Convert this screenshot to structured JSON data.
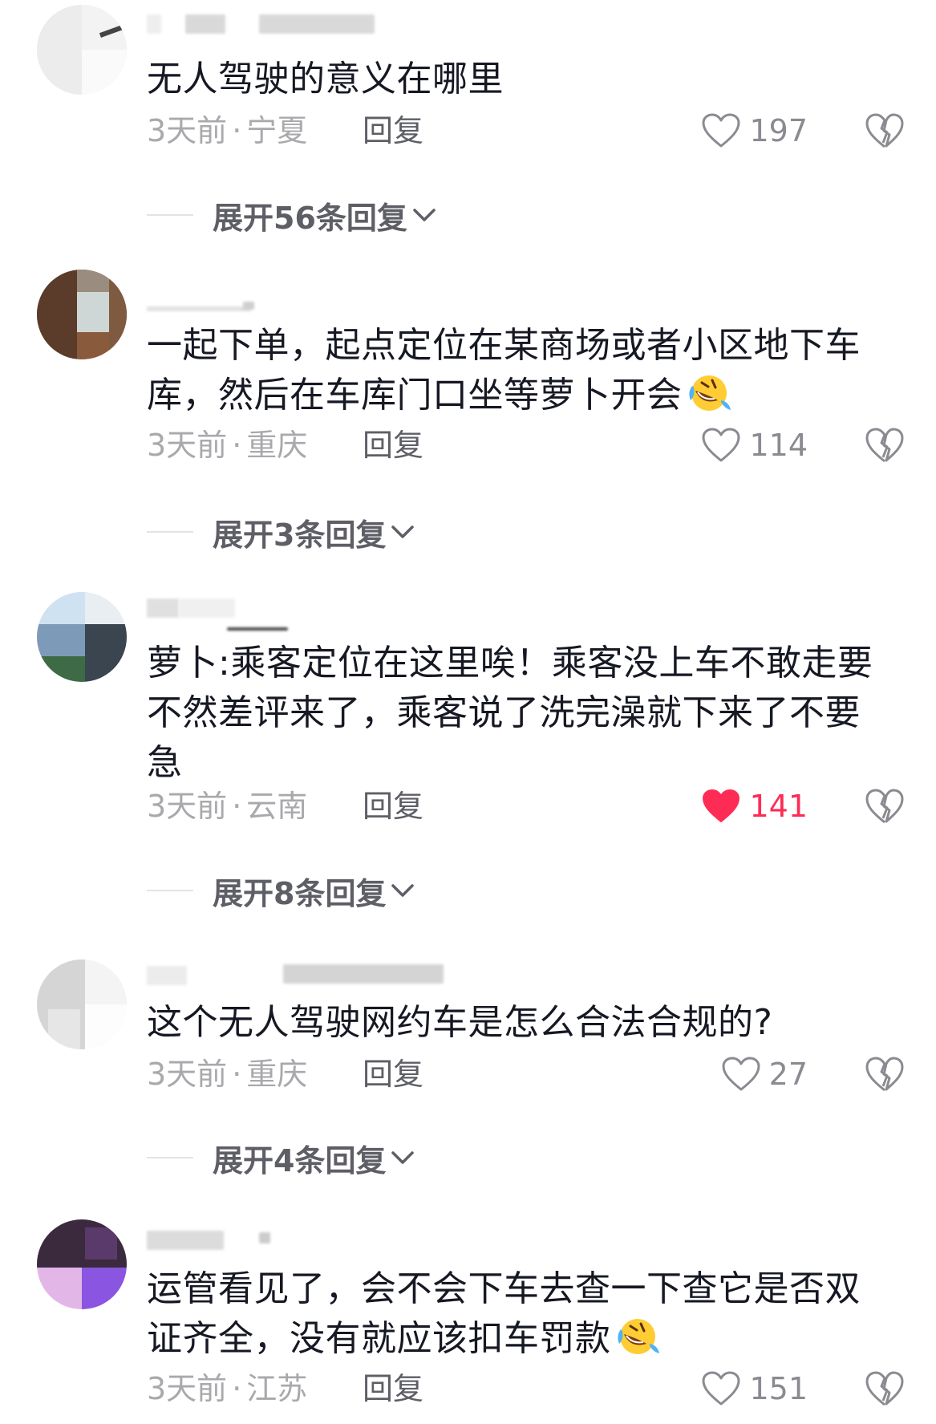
{
  "comments": [
    {
      "text": "无人驾驶的意义在哪里",
      "time": "3天前",
      "location": "宁夏",
      "reply_label": "回复",
      "likes": "197",
      "liked": false,
      "expand_label": "展开56条回复"
    },
    {
      "text": "一起下单，起点定位在某商场或者小区地下车库，然后在车库门口坐等萝卜开会",
      "emoji": "rolling-on-floor-laughing-emoji",
      "time": "3天前",
      "location": "重庆",
      "reply_label": "回复",
      "likes": "114",
      "liked": false,
      "expand_label": "展开3条回复"
    },
    {
      "text": "萝卜:乘客定位在这里唉！乘客没上车不敢走要不然差评来了，乘客说了洗完澡就下来了不要急",
      "time": "3天前",
      "location": "云南",
      "reply_label": "回复",
      "likes": "141",
      "liked": true,
      "expand_label": "展开8条回复"
    },
    {
      "text": "这个无人驾驶网约车是怎么合法合规的?",
      "time": "3天前",
      "location": "重庆",
      "reply_label": "回复",
      "likes": "27",
      "liked": false,
      "expand_label": "展开4条回复"
    },
    {
      "text": "运管看见了，会不会下车去查一下查它是否双证齐全，没有就应该扣车罚款",
      "emoji": "rolling-on-floor-laughing-emoji",
      "time": "3天前",
      "location": "江苏",
      "reply_label": "回复",
      "likes": "151",
      "liked": false
    }
  ],
  "separator": "·",
  "colors": {
    "text": "#161823",
    "meta": "#a9a9ad",
    "action": "#5e5f66",
    "like_active": "#fe2c55"
  },
  "icons": {
    "like": "heart-outline-icon",
    "liked": "heart-filled-icon",
    "dislike": "broken-heart-icon",
    "expand": "chevron-down-icon"
  }
}
